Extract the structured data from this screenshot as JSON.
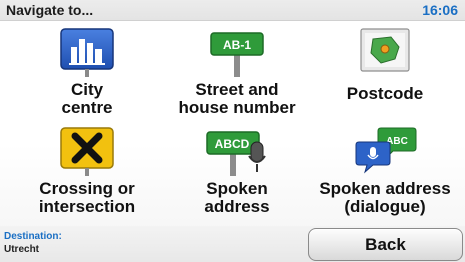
{
  "header": {
    "title": "Navigate to...",
    "time": "16:06"
  },
  "tiles": [
    {
      "icon": "city-skyline-icon",
      "label_line1": "City",
      "label_line2": "centre"
    },
    {
      "icon": "street-sign-icon",
      "sign_text": "AB-1",
      "label_line1": "Street and",
      "label_line2": "house number"
    },
    {
      "icon": "postcode-map-icon",
      "label_line1": "Postcode",
      "label_line2": ""
    },
    {
      "icon": "crossing-icon",
      "label_line1": "Crossing or",
      "label_line2": "intersection"
    },
    {
      "icon": "spoken-address-icon",
      "sign_text": "ABCD",
      "label_line1": "Spoken",
      "label_line2": "address"
    },
    {
      "icon": "spoken-dialogue-icon",
      "bubble_text": "ABC",
      "label_line1": "Spoken address",
      "label_line2": "(dialogue)"
    }
  ],
  "footer": {
    "destination_label": "Destination:",
    "destination_value": "Utrecht",
    "back_label": "Back"
  },
  "colors": {
    "accent_blue": "#1a6fc4",
    "sign_green": "#2f9b3a",
    "city_blue": "#2d63c8",
    "crossing_yellow": "#f2c10f"
  }
}
